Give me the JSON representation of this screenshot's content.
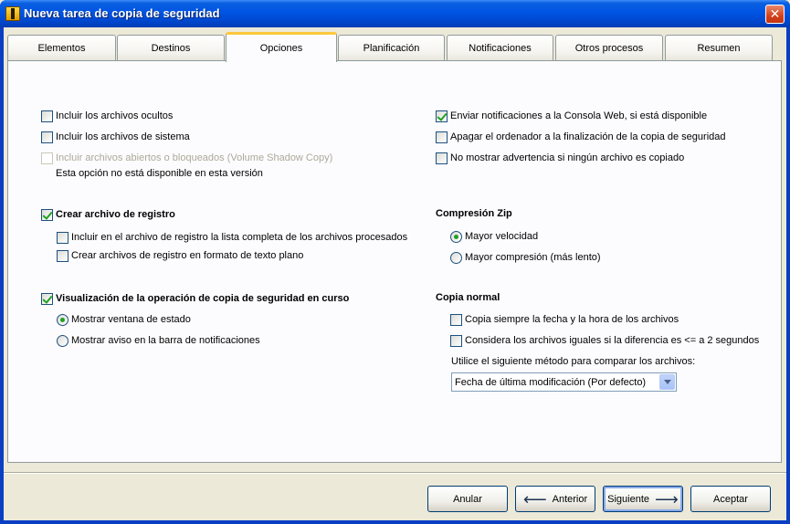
{
  "window": {
    "title": "Nueva tarea de copia de seguridad",
    "close_symbol": "✕"
  },
  "tabs": [
    {
      "label": "Elementos"
    },
    {
      "label": "Destinos"
    },
    {
      "label": "Opciones",
      "active": true
    },
    {
      "label": "Planificación"
    },
    {
      "label": "Notificaciones"
    },
    {
      "label": "Otros procesos"
    },
    {
      "label": "Resumen"
    }
  ],
  "left": {
    "include_hidden": {
      "label": "Incluir los archivos ocultos",
      "checked": false
    },
    "include_system": {
      "label": "Incluir los archivos de sistema",
      "checked": false
    },
    "include_open": {
      "label": "Incluir archivos abiertos o bloqueados (Volume Shadow Copy)",
      "checked": false,
      "disabled": true
    },
    "unavailable_note": "Esta opción no está disponible en esta versión",
    "create_log": {
      "label": "Crear archivo de registro",
      "checked": true
    },
    "log_full_list": {
      "label": "Incluir en el archivo de registro la lista completa de los archivos procesados",
      "checked": false
    },
    "log_plain_text": {
      "label": "Crear archivos de registro en formato de texto plano",
      "checked": false
    },
    "show_progress": {
      "label": "Visualización de la operación de copia de seguridad en curso",
      "checked": true
    },
    "show_status_window": {
      "label": "Mostrar ventana de estado",
      "selected": true
    },
    "show_tray_notice": {
      "label": "Mostrar aviso en la barra de notificaciones",
      "selected": false
    }
  },
  "right": {
    "notify_web_console": {
      "label": "Enviar notificaciones a la Consola Web, si está disponible",
      "checked": true
    },
    "shutdown_after": {
      "label": "Apagar el ordenador a la finalización de la copia de seguridad",
      "checked": false
    },
    "no_warning": {
      "label": "No mostrar advertencia si ningún archivo es copiado",
      "checked": false
    },
    "zip_heading": "Compresión Zip",
    "zip_speed": {
      "label": "Mayor velocidad",
      "selected": true
    },
    "zip_compression": {
      "label": "Mayor compresión (más lento)",
      "selected": false
    },
    "normal_heading": "Copia normal",
    "copy_datetime": {
      "label": "Copia siempre la fecha y la hora de los archivos",
      "checked": false
    },
    "equal_if_diff": {
      "label": "Considera los archivos iguales si la diferencia es <= a 2 segundos",
      "checked": false
    },
    "compare_method_label": "Utilice el siguiente método para comparar los archivos:",
    "compare_method_value": "Fecha de última modificación (Por defecto)"
  },
  "buttons": {
    "cancel": "Anular",
    "back": "Anterior",
    "next": "Siguiente",
    "accept": "Aceptar"
  }
}
